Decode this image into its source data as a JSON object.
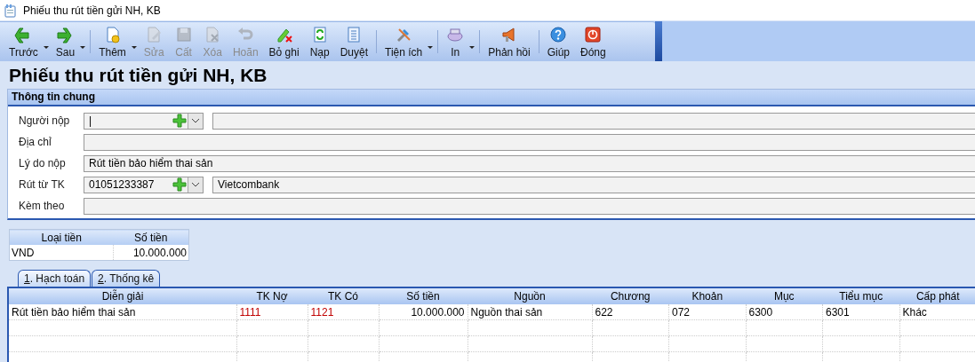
{
  "window": {
    "title": "Phiếu thu rút tiền gửi NH, KB"
  },
  "toolbar": [
    {
      "kind": "button",
      "label": "Trước",
      "disabled": false,
      "dropdown": true
    },
    {
      "kind": "button",
      "label": "Sau",
      "disabled": false,
      "dropdown": true
    },
    {
      "kind": "separator"
    },
    {
      "kind": "button",
      "label": "Thêm",
      "disabled": false,
      "dropdown": true
    },
    {
      "kind": "button",
      "label": "Sửa",
      "disabled": true,
      "dropdown": false
    },
    {
      "kind": "button",
      "label": "Cất",
      "disabled": true,
      "dropdown": false
    },
    {
      "kind": "button",
      "label": "Xóa",
      "disabled": true,
      "dropdown": false
    },
    {
      "kind": "button",
      "label": "Hoãn",
      "disabled": true,
      "dropdown": false
    },
    {
      "kind": "button",
      "label": "Bỏ ghi",
      "disabled": false,
      "dropdown": false
    },
    {
      "kind": "button",
      "label": "Nạp",
      "disabled": false,
      "dropdown": false
    },
    {
      "kind": "button",
      "label": "Duyệt",
      "disabled": false,
      "dropdown": false
    },
    {
      "kind": "separator"
    },
    {
      "kind": "button",
      "label": "Tiện ích",
      "disabled": false,
      "dropdown": true
    },
    {
      "kind": "separator"
    },
    {
      "kind": "button",
      "label": "In",
      "disabled": false,
      "dropdown": true
    },
    {
      "kind": "separator"
    },
    {
      "kind": "button",
      "label": "Phản hồi",
      "disabled": false,
      "dropdown": false
    },
    {
      "kind": "separator"
    },
    {
      "kind": "button",
      "label": "Giúp",
      "disabled": false,
      "dropdown": false
    },
    {
      "kind": "button",
      "label": "Đóng",
      "disabled": false,
      "dropdown": false
    }
  ],
  "heading": "Phiếu thu rút tiền gửi NH, KB",
  "general": {
    "title": "Thông tin chung",
    "fields": [
      {
        "kind": "combo",
        "label": "Người nộp",
        "value": "|"
      },
      {
        "kind": "text",
        "label": "Địa chỉ"
      },
      {
        "kind": "text",
        "label": "Lý do nộp",
        "value": "Rút tiền bảo hiểm thai sản"
      },
      {
        "kind": "combo",
        "label": "Rút từ TK",
        "value": "01051233387",
        "detail": "Vietcombank"
      },
      {
        "kind": "text",
        "label": "Kèm theo"
      }
    ]
  },
  "currency": {
    "columns": [
      "Loại tiền",
      "Số tiền"
    ],
    "rows": [
      [
        "VND",
        "10.000.000"
      ]
    ]
  },
  "tabs": [
    {
      "key": "1",
      "label": ". Hạch toán",
      "selected": true
    },
    {
      "key": "2",
      "label": ". Thống kê",
      "selected": false
    }
  ],
  "entries": {
    "columns": [
      {
        "label": "Diễn giải",
        "kind": "text"
      },
      {
        "label": "TK Nợ",
        "kind": "account"
      },
      {
        "label": "TK Có",
        "kind": "account"
      },
      {
        "label": "Số tiền",
        "kind": "amount"
      },
      {
        "label": "Nguồn",
        "kind": "text"
      },
      {
        "label": "Chương",
        "kind": "text"
      },
      {
        "label": "Khoản",
        "kind": "text"
      },
      {
        "label": "Mục",
        "kind": "text"
      },
      {
        "label": "Tiểu mục",
        "kind": "text"
      },
      {
        "label": "Cấp phát",
        "kind": "text"
      }
    ],
    "rows": [
      [
        "Rút tiền bảo hiểm thai sản",
        "1111",
        "1121",
        "10.000.000",
        "Nguồn thai sản",
        "622",
        "072",
        "6300",
        "6301",
        "Khác"
      ]
    ]
  }
}
